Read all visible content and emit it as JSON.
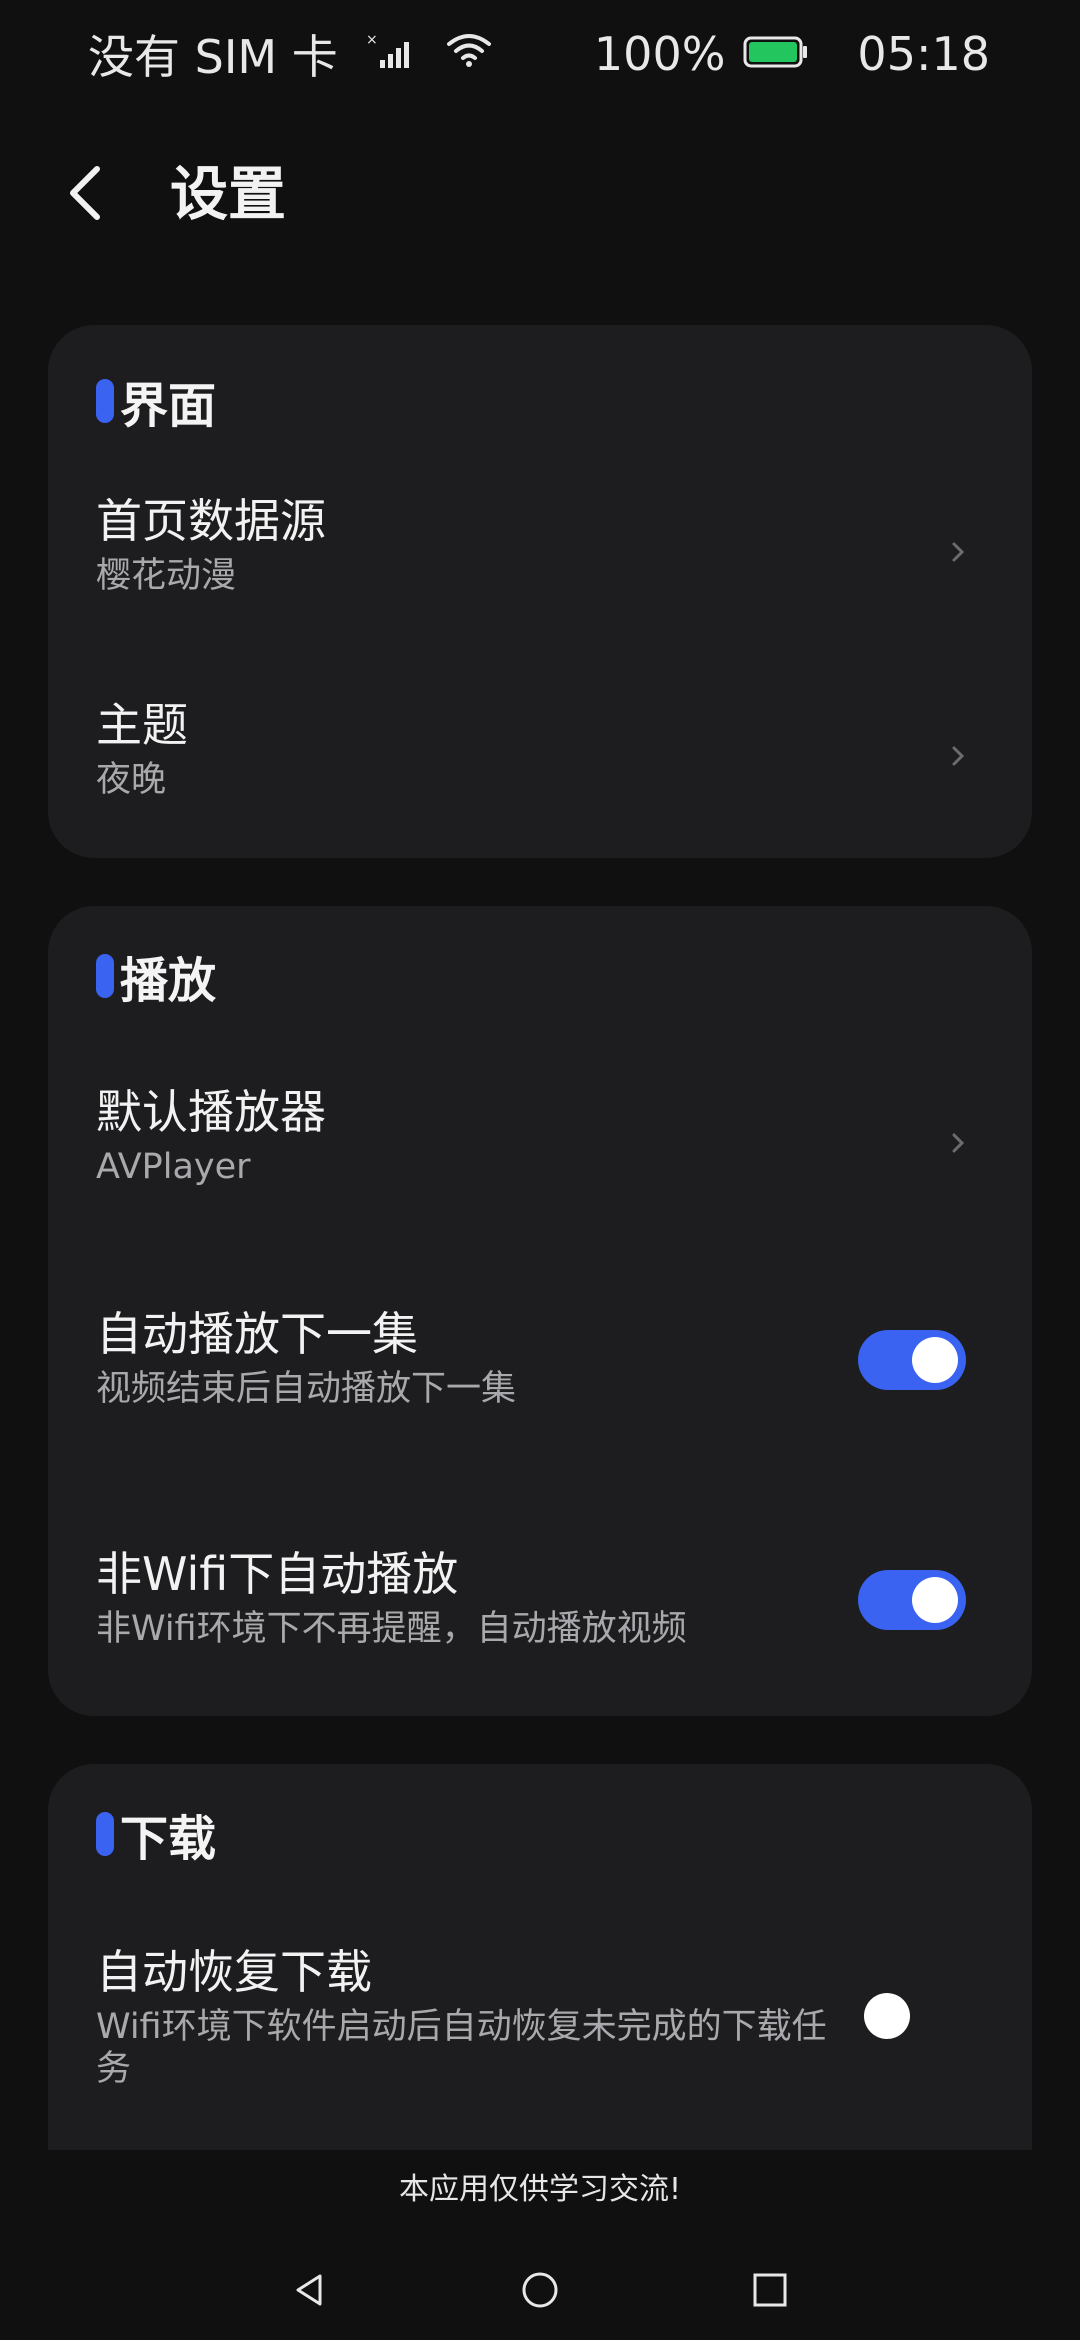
{
  "status_bar": {
    "carrier": "没有 SIM 卡",
    "battery_percent": "100%",
    "time": "05:18",
    "icons": [
      "no-sim-signal-icon",
      "wifi-icon",
      "battery-icon"
    ],
    "battery_color": "#22c55e"
  },
  "header": {
    "title": "设置",
    "back_icon": "chevron-left-icon"
  },
  "sections": {
    "interface": {
      "title": "界面",
      "home_source": {
        "title": "首页数据源",
        "value": "樱花动漫"
      },
      "theme": {
        "title": "主题",
        "value": "夜晚"
      }
    },
    "playback": {
      "title": "播放",
      "default_player": {
        "title": "默认播放器",
        "value": "AVPlayer"
      },
      "autoplay_next": {
        "title": "自动播放下一集",
        "desc": "视频结束后自动播放下一集",
        "enabled": true
      },
      "non_wifi_autoplay": {
        "title": "非Wifi下自动播放",
        "desc": "非Wifi环境下不再提醒，自动播放视频",
        "enabled": true
      }
    },
    "download": {
      "title": "下载",
      "auto_resume": {
        "title": "自动恢复下载",
        "desc": "Wifi环境下软件启动后自动恢复未完成的下载任务",
        "enabled": false
      }
    }
  },
  "footer": {
    "notice": "本应用仅供学习交流!"
  },
  "nav_bar": {
    "icons": [
      "back-triangle-icon",
      "home-circle-icon",
      "recents-square-icon"
    ]
  },
  "colors": {
    "accent": "#3a63f2",
    "background": "#101010",
    "card": "#1d1d1f"
  }
}
